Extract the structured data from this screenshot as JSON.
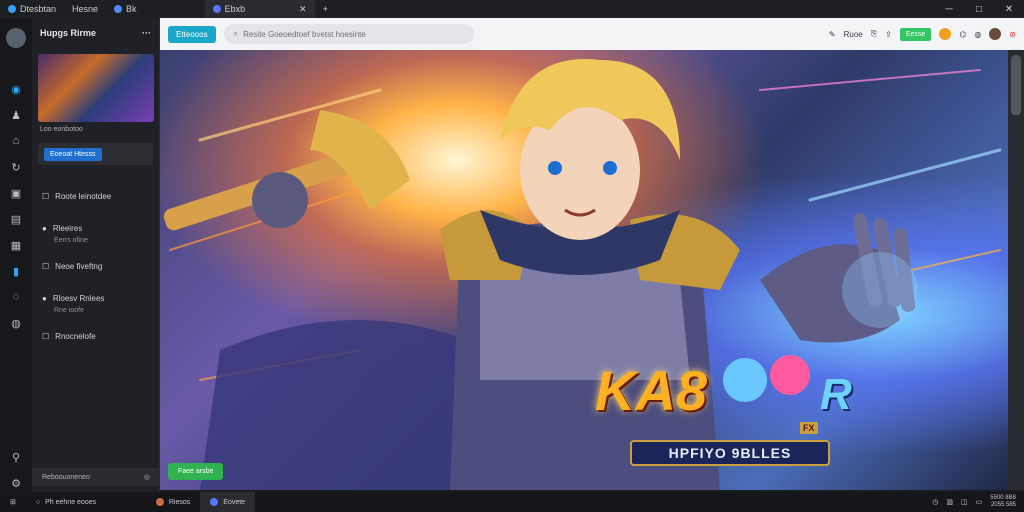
{
  "titlebar": {
    "tabs": [
      {
        "label": "Dtesbtan",
        "active": false
      },
      {
        "label": "Hesne",
        "active": false
      },
      {
        "label": "Bk",
        "active": false
      },
      {
        "label": "Ebxb",
        "active": true
      }
    ],
    "new_tab": "+",
    "minimize": "─",
    "maximize": "□",
    "close": "✕"
  },
  "sidebar": {
    "title": "Hupgs Rirme",
    "menu": "···",
    "thumb_caption": "Loo eonbotoo",
    "button_label": "Eoeoat Htesss",
    "items": [
      {
        "icon": "☐",
        "label": "Roote leinotdee"
      },
      {
        "icon": "●",
        "label": "Rleeires",
        "sub": "Eerrs ofine"
      },
      {
        "icon": "☐",
        "label": "Neoe fiveftng"
      },
      {
        "icon": "●",
        "label": "Rloesv Rnlees",
        "sub": "Rne ioofe"
      },
      {
        "icon": "☐",
        "label": "Rnocnelofe"
      }
    ],
    "footer": "Reboouoneneo"
  },
  "toolbar": {
    "badge": "Etteooos",
    "search_placeholder": "Resite Goeoedtoef bvetst hoesinte",
    "right_label": "Ruoe",
    "green_label": "Eesse"
  },
  "art": {
    "logo_big": "KA8",
    "logo_r": "R",
    "logo_sub": "HPFIYO 9BLLES",
    "fx": "FX",
    "bottom_button": "Faee arsbe"
  },
  "taskbar": {
    "start": "Ph eehne eooes",
    "tasks": [
      {
        "label": "Riesos",
        "active": false
      },
      {
        "label": "Eovete",
        "active": true
      }
    ],
    "clock_time": "5500 8B8",
    "clock_date": "2055 585"
  },
  "colors": {
    "accent_teal": "#1aa7c9",
    "accent_blue": "#1f6fd1",
    "accent_green": "#33c463"
  }
}
